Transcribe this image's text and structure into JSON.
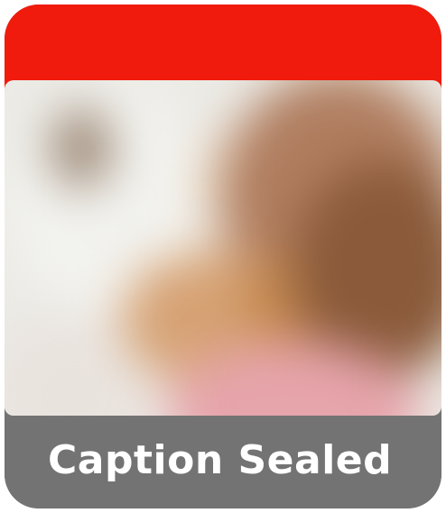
{
  "caption": {
    "text": "Caption Sealed"
  },
  "colors": {
    "brand_red": "#f01b0c",
    "caption_background": "#737373",
    "caption_text": "#ffffff"
  }
}
